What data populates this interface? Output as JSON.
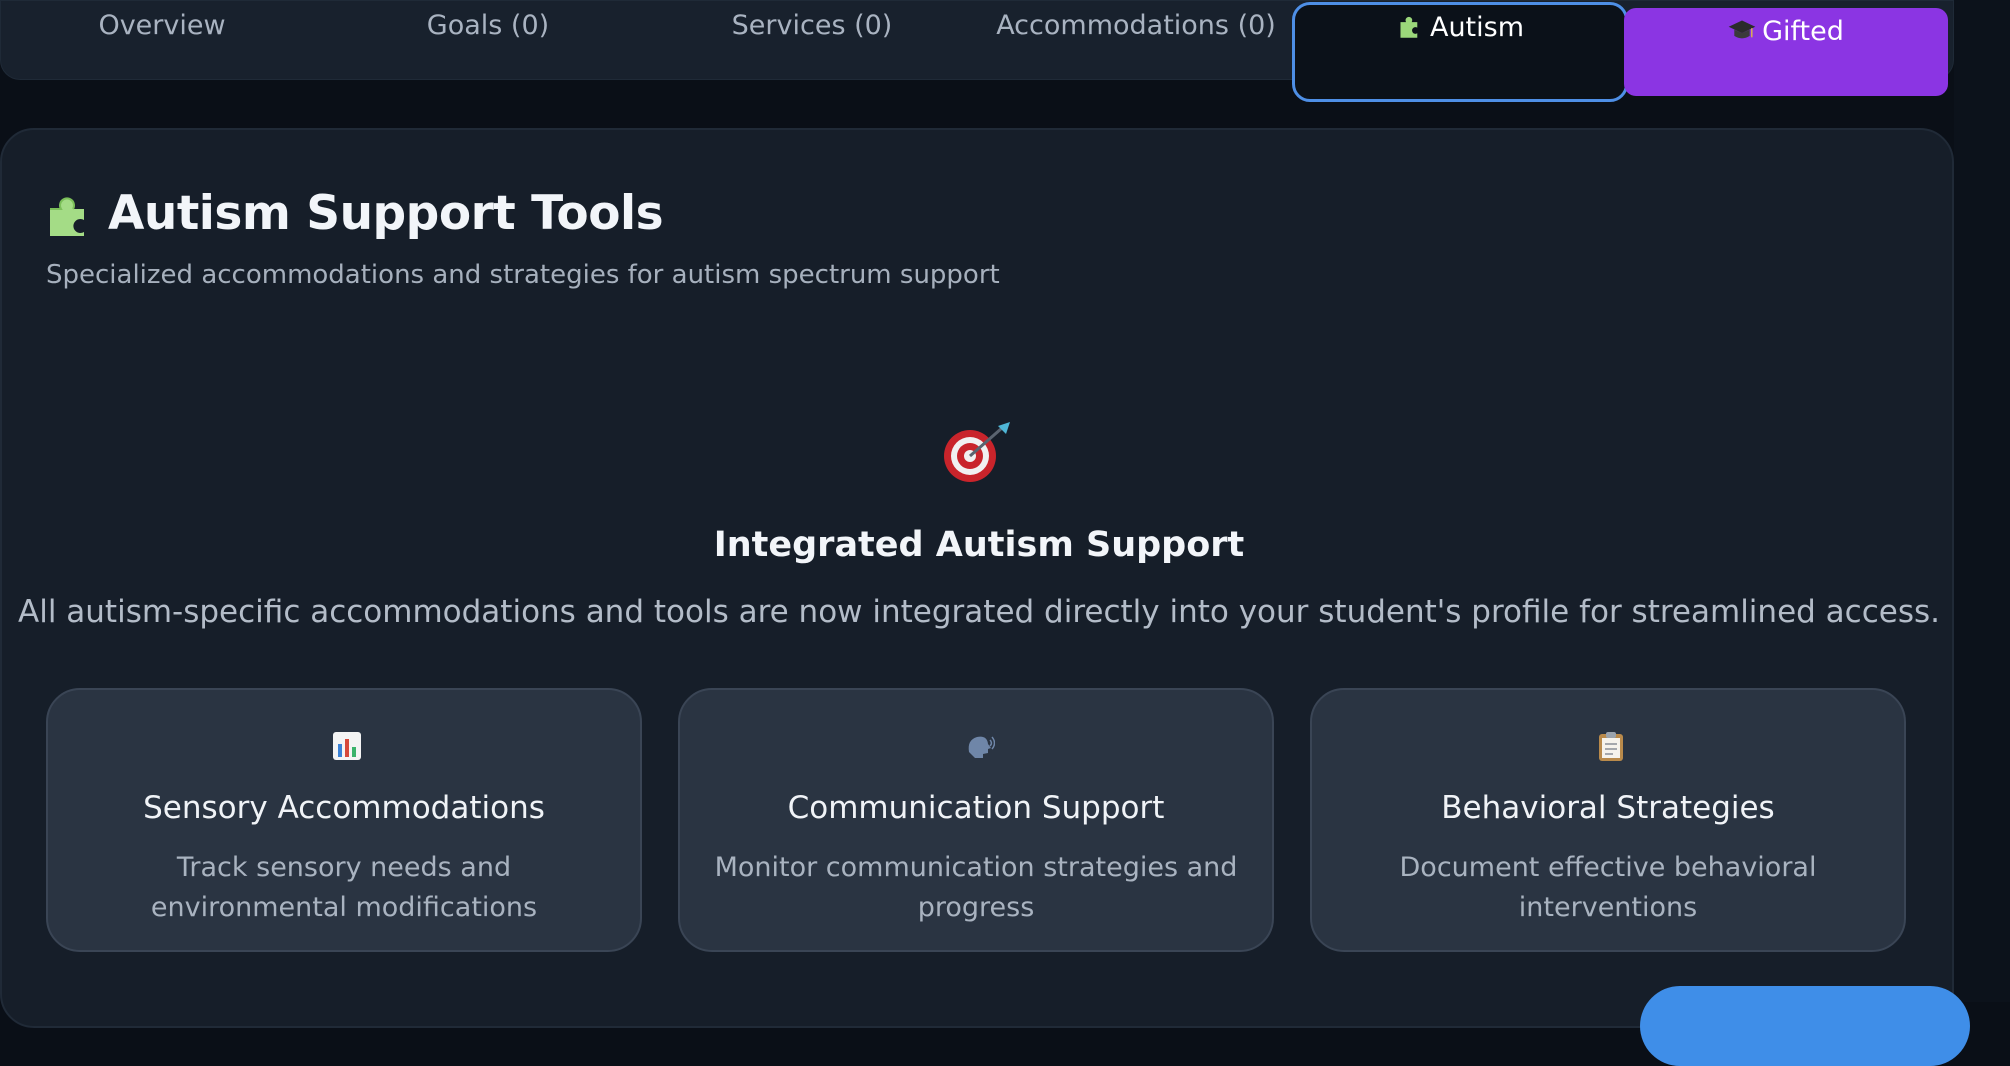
{
  "tabs": {
    "overview": "Overview",
    "goals": "Goals (0)",
    "services": "Services (0)",
    "accommodations": "Accommodations (0)",
    "autism": "Autism",
    "gifted": "Gifted",
    "active": "autism"
  },
  "header": {
    "title": "Autism Support Tools",
    "subtitle": "Specialized accommodations and strategies for autism spectrum support",
    "icon": "puzzle-piece-icon"
  },
  "integrated": {
    "icon": "target-icon",
    "title": "Integrated Autism Support",
    "description": "All autism-specific accommodations and tools are now integrated directly into your student's profile for streamlined access."
  },
  "cards": [
    {
      "icon": "bar-chart-icon",
      "title": "Sensory Accommodations",
      "description": "Track sensory needs and environmental modifications"
    },
    {
      "icon": "speaking-head-icon",
      "title": "Communication Support",
      "description": "Monitor communication strategies and progress"
    },
    {
      "icon": "clipboard-icon",
      "title": "Behavioral Strategies",
      "description": "Document effective behavioral interventions"
    }
  ],
  "colors": {
    "accent_blue": "#4e8fe6",
    "gifted_purple": "#8b35e3",
    "panel_bg": "#161e29",
    "card_bg": "#2a3442"
  }
}
